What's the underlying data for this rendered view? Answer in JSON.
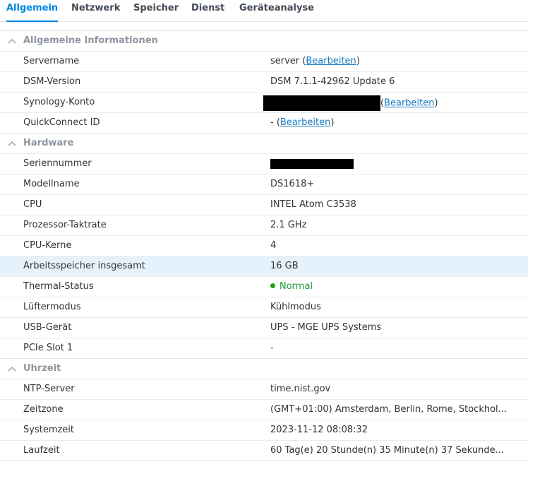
{
  "tabs": [
    {
      "label": "Allgemein",
      "active": true
    },
    {
      "label": "Netzwerk"
    },
    {
      "label": "Speicher"
    },
    {
      "label": "Dienst"
    },
    {
      "label": "Geräteanalyse"
    }
  ],
  "sections": {
    "general": {
      "title": "Allgemeine Informationen",
      "servername": {
        "label": "Servername",
        "value": "server",
        "edit": "Bearbeiten"
      },
      "dsm": {
        "label": "DSM-Version",
        "value": "DSM 7.1.1-42962 Update 6"
      },
      "account": {
        "label": "Synology-Konto",
        "edit": "Bearbeiten"
      },
      "quickconnect": {
        "label": "QuickConnect ID",
        "value": "-",
        "edit": "Bearbeiten"
      }
    },
    "hardware": {
      "title": "Hardware",
      "serial": {
        "label": "Seriennummer"
      },
      "model": {
        "label": "Modellname",
        "value": "DS1618+"
      },
      "cpu": {
        "label": "CPU",
        "value": "INTEL Atom C3538"
      },
      "clock": {
        "label": "Prozessor-Taktrate",
        "value": "2.1 GHz"
      },
      "cores": {
        "label": "CPU-Kerne",
        "value": "4"
      },
      "memory": {
        "label": "Arbeitsspeicher insgesamt",
        "value": "16 GB"
      },
      "thermal": {
        "label": "Thermal-Status",
        "value": "Normal",
        "color": "#1d9a36"
      },
      "fan": {
        "label": "Lüftermodus",
        "value": "Kühlmodus"
      },
      "usb": {
        "label": "USB-Gerät",
        "value": "UPS - MGE UPS Systems"
      },
      "pcie": {
        "label": "PCIe Slot 1",
        "value": "-"
      }
    },
    "time": {
      "title": "Uhrzeit",
      "ntp": {
        "label": "NTP-Server",
        "value": "time.nist.gov"
      },
      "timezone": {
        "label": "Zeitzone",
        "value": "(GMT+01:00) Amsterdam, Berlin, Rome, Stockhol..."
      },
      "systime": {
        "label": "Systemzeit",
        "value": "2023-11-12 08:08:32"
      },
      "uptime": {
        "label": "Laufzeit",
        "value": "60 Tag(e) 20 Stunde(n) 35 Minute(n) 37 Sekunde..."
      }
    }
  }
}
